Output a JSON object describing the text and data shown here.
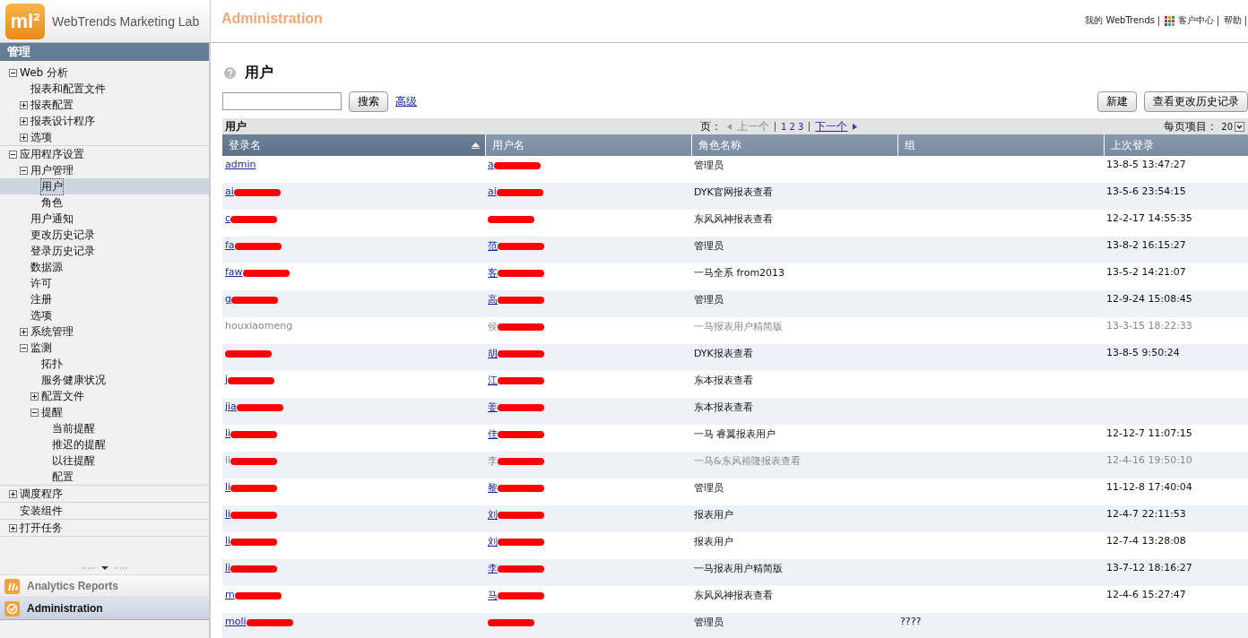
{
  "header": {
    "logo_text": "ml²",
    "product": "WebTrends Marketing Lab",
    "section": "Administration",
    "links": [
      {
        "label": "我的 WebTrends",
        "kind": "text"
      },
      {
        "label": "客户中心",
        "kind": "grid"
      },
      {
        "label": "帮助",
        "kind": "text"
      }
    ]
  },
  "sidebar": {
    "title": "管理",
    "tree": [
      {
        "label": "Web 分析",
        "expanded": true,
        "selected": false,
        "children": [
          {
            "label": "报表和配置文件",
            "selected": false
          },
          {
            "label": "报表配置",
            "expanded": false,
            "selected": false
          },
          {
            "label": "报表设计程序",
            "expanded": false,
            "selected": false
          },
          {
            "label": "选项",
            "expanded": false,
            "selected": false
          }
        ]
      },
      {
        "label": "应用程序设置",
        "expanded": true,
        "selected": false,
        "children": [
          {
            "label": "用户管理",
            "expanded": true,
            "selected": false,
            "children": [
              {
                "label": "用户",
                "selected": true
              },
              {
                "label": "角色",
                "selected": false
              }
            ]
          },
          {
            "label": "用户通知",
            "selected": false
          },
          {
            "label": "更改历史记录",
            "selected": false
          },
          {
            "label": "登录历史记录",
            "selected": false
          },
          {
            "label": "数据源",
            "selected": false
          },
          {
            "label": "许可",
            "selected": false
          },
          {
            "label": "注册",
            "selected": false
          },
          {
            "label": "选项",
            "selected": false
          },
          {
            "label": "系统管理",
            "expanded": false,
            "selected": false
          },
          {
            "label": "监测",
            "expanded": true,
            "selected": false,
            "children": [
              {
                "label": "拓扑",
                "selected": false
              },
              {
                "label": "服务健康状况",
                "selected": false
              },
              {
                "label": "配置文件",
                "expanded": false,
                "selected": false
              },
              {
                "label": "提醒",
                "expanded": true,
                "selected": false,
                "children": [
                  {
                    "label": "当前提醒",
                    "selected": false
                  },
                  {
                    "label": "推迟的提醒",
                    "selected": false
                  },
                  {
                    "label": "以往提醒",
                    "selected": false
                  },
                  {
                    "label": "配置",
                    "selected": false
                  }
                ]
              }
            ]
          }
        ]
      },
      {
        "label": "调度程序",
        "expanded": false,
        "selected": false
      },
      {
        "label": "安装组件",
        "selected": false
      },
      {
        "label": "打开任务",
        "expanded": false,
        "selected": false
      }
    ],
    "apps": [
      {
        "label": "Analytics Reports",
        "kind": "reports",
        "selected": false
      },
      {
        "label": "Administration",
        "kind": "admin",
        "selected": true
      }
    ]
  },
  "page": {
    "title": "用户",
    "search": {
      "button": "搜索",
      "advanced": "高级"
    },
    "buttons": [
      "新建",
      "查看更改历史记录"
    ]
  },
  "table": {
    "caption": "用户",
    "pager": {
      "label": "页：",
      "prev": "上一个",
      "pages": "1 2 3",
      "next": "下一个",
      "per_page_label": "每页项目：",
      "per_page": "20"
    },
    "columns": [
      {
        "label": "登录名",
        "sorted": true
      },
      {
        "label": "用户名",
        "sorted": false
      },
      {
        "label": "角色名称",
        "sorted": false
      },
      {
        "label": "组",
        "sorted": false
      },
      {
        "label": "上次登录",
        "sorted": false
      }
    ],
    "rows": [
      {
        "disabled": false,
        "login": {
          "text": "admin",
          "redacted": false
        },
        "user": {
          "text": "a",
          "redacted": true
        },
        "role": "管理员",
        "last_login": "13-8-5 13:47:27"
      },
      {
        "disabled": false,
        "login": {
          "text": "ai",
          "redacted": true
        },
        "user": {
          "text": "ai",
          "redacted": true
        },
        "role": "DYK官网报表查看",
        "last_login": "13-5-6 23:54:15"
      },
      {
        "disabled": false,
        "login": {
          "text": "c",
          "redacted": true
        },
        "user": {
          "redacted": true
        },
        "role": "东风风神报表查看",
        "last_login": "12-2-17 14:55:35"
      },
      {
        "disabled": false,
        "login": {
          "text": "fa",
          "redacted": true
        },
        "user": {
          "text": "范",
          "redacted": true
        },
        "role": "管理员",
        "last_login": "13-8-2 16:15:27"
      },
      {
        "disabled": false,
        "login": {
          "text": "faw",
          "redacted": true
        },
        "user": {
          "text": "客",
          "redacted": true
        },
        "role": "一马全系 from2013",
        "last_login": "13-5-2 14:21:07"
      },
      {
        "disabled": false,
        "login": {
          "text": "g",
          "redacted": true
        },
        "user": {
          "text": "高",
          "redacted": true
        },
        "role": "管理员",
        "last_login": "12-9-24 15:08:45"
      },
      {
        "disabled": true,
        "login": {
          "text": "houxiaomeng",
          "redacted": false
        },
        "user": {
          "text": "侯",
          "redacted": true
        },
        "role": "一马报表用户精简版",
        "last_login": "13-3-15 18:22:33"
      },
      {
        "disabled": false,
        "login": {
          "redacted": true
        },
        "user": {
          "text": "胡",
          "redacted": true
        },
        "role": "DYK报表查看",
        "last_login": "13-8-5 9:50:24"
      },
      {
        "disabled": false,
        "login": {
          "text": "j",
          "redacted": true
        },
        "user": {
          "text": "江",
          "redacted": true
        },
        "role": "东本报表查看"
      },
      {
        "disabled": false,
        "login": {
          "text": "jia",
          "redacted": true
        },
        "user": {
          "text": "姜",
          "redacted": true
        },
        "role": "东本报表查看"
      },
      {
        "disabled": false,
        "login": {
          "text": "li",
          "redacted": true
        },
        "user": {
          "text": "佳",
          "redacted": true
        },
        "role": "一马 睿翼报表用户",
        "last_login": "12-12-7 11:07:15"
      },
      {
        "disabled": true,
        "login": {
          "text": "li",
          "redacted": true
        },
        "user": {
          "text": "李",
          "redacted": true
        },
        "role": "一马&东风裕隆报表查看",
        "last_login": "12-4-16 19:50:10"
      },
      {
        "disabled": false,
        "login": {
          "text": "li",
          "redacted": true
        },
        "user": {
          "text": "黎",
          "redacted": true
        },
        "role": "管理员",
        "last_login": "11-12-8 17:40:04"
      },
      {
        "disabled": false,
        "login": {
          "text": "li",
          "redacted": true
        },
        "user": {
          "text": "刘",
          "redacted": true
        },
        "role": "报表用户",
        "last_login": "12-4-7 22:11:53"
      },
      {
        "disabled": false,
        "login": {
          "text": "li",
          "redacted": true
        },
        "user": {
          "text": "刘",
          "redacted": true
        },
        "role": "报表用户",
        "last_login": "12-7-4 13:28:08"
      },
      {
        "disabled": false,
        "login": {
          "text": "li",
          "redacted": true
        },
        "user": {
          "text": "李",
          "redacted": true
        },
        "role": "一马报表用户精简版",
        "last_login": "13-7-12 18:16:27"
      },
      {
        "disabled": false,
        "login": {
          "text": "m",
          "redacted": true
        },
        "user": {
          "text": "马",
          "redacted": true
        },
        "role": "东风风神报表查看",
        "last_login": "12-4-6 15:27:47"
      },
      {
        "disabled": false,
        "login": {
          "text": "moli",
          "redacted": true
        },
        "user": {
          "redacted": true
        },
        "role": "管理员",
        "group": "????"
      }
    ]
  }
}
